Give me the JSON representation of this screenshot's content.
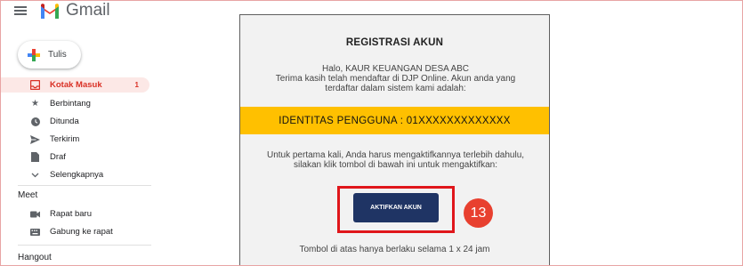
{
  "gmail": {
    "brand": "Gmail",
    "compose_label": "Tulis",
    "nav": [
      {
        "label": "Kotak Masuk",
        "count": "1",
        "icon": "inbox-icon"
      },
      {
        "label": "Berbintang",
        "icon": "star-icon"
      },
      {
        "label": "Ditunda",
        "icon": "clock-icon"
      },
      {
        "label": "Terkirim",
        "icon": "send-icon"
      },
      {
        "label": "Draf",
        "icon": "draft-icon"
      },
      {
        "label": "Selengkapnya",
        "icon": "chevron-down-icon"
      }
    ],
    "meet": {
      "title": "Meet",
      "items": [
        {
          "label": "Rapat baru",
          "icon": "video-icon"
        },
        {
          "label": "Gabung ke rapat",
          "icon": "keyboard-icon"
        }
      ]
    },
    "hangout_title": "Hangout"
  },
  "email": {
    "title": "REGISTRASI AKUN",
    "greeting_line1": "Halo, KAUR KEUANGAN DESA ABC",
    "greeting_line2": "Terima kasih telah mendaftar di DJP Online. Akun anda yang",
    "greeting_line3": "terdaftar dalam sistem kami adalah:",
    "identity": "IDENTITAS PENGGUNA : 01XXXXXXXXXXXXX",
    "instruct_line1": "Untuk pertama kali, Anda harus mengaktifkannya terlebih dahulu,",
    "instruct_line2": "silakan klik tombol di bawah ini untuk mengaktifkan:",
    "button_label": "AKTIFKAN AKUN",
    "footer": "Tombol di atas hanya berlaku selama 1 x 24 jam"
  },
  "annotation": {
    "step": "13"
  },
  "colors": {
    "accent_red": "#e0161b",
    "identity_bar": "#ffc000",
    "button": "#1f3464",
    "active_nav": "#fce8e6"
  }
}
